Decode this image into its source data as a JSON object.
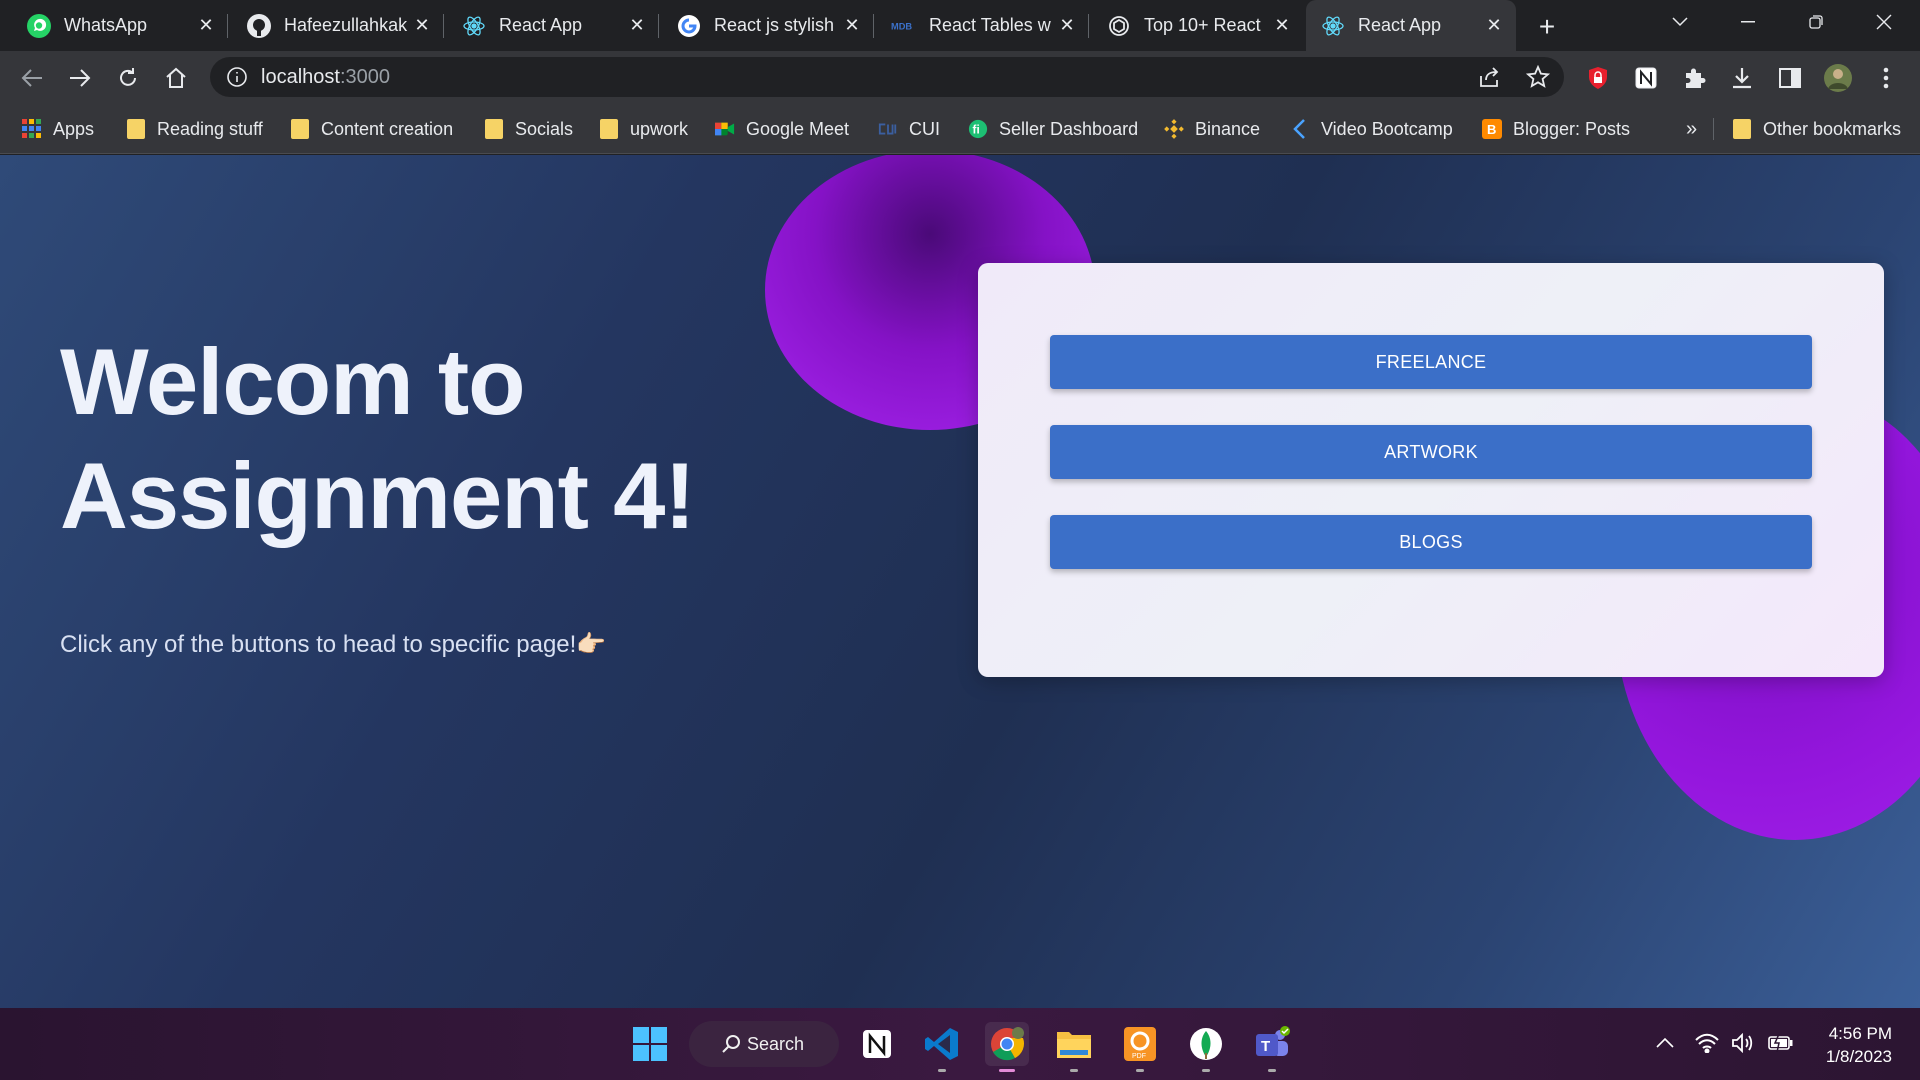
{
  "tabs": [
    {
      "title": "WhatsApp",
      "icon": "whatsapp-icon"
    },
    {
      "title": "Hafeezullahkak",
      "icon": "github-icon"
    },
    {
      "title": "React App",
      "icon": "react-icon"
    },
    {
      "title": "React js stylish",
      "icon": "google-icon"
    },
    {
      "title": "React Tables w",
      "icon": "mdb-icon"
    },
    {
      "title": "Top 10+ React",
      "icon": "openai-icon"
    },
    {
      "title": "React App",
      "icon": "react-icon",
      "active": true
    }
  ],
  "address_bar": {
    "host": "localhost",
    "port": ":3000"
  },
  "bookmarks": [
    {
      "label": "Apps",
      "icon": "apps-grid-icon"
    },
    {
      "label": "Reading stuff",
      "icon": "folder-icon"
    },
    {
      "label": "Content creation",
      "icon": "folder-icon"
    },
    {
      "label": "Socials",
      "icon": "folder-icon"
    },
    {
      "label": "upwork",
      "icon": "folder-icon"
    },
    {
      "label": "Google Meet",
      "icon": "google-meet-icon"
    },
    {
      "label": "CUI",
      "icon": "cui-icon"
    },
    {
      "label": "Seller Dashboard",
      "icon": "fiverr-icon"
    },
    {
      "label": "Binance",
      "icon": "binance-icon"
    },
    {
      "label": "Video Bootcamp",
      "icon": "bootcamp-icon"
    },
    {
      "label": "Blogger: Posts",
      "icon": "blogger-icon"
    }
  ],
  "bookmarks_overflow": "»",
  "other_bookmarks": "Other bookmarks",
  "page": {
    "title_line1": "Welcom to",
    "title_line2": "Assignment 4!",
    "subtitle": "Click any of the buttons to head to specific page!👉🏻",
    "buttons": [
      "FREELANCE",
      "ARTWORK",
      "BLOGS"
    ]
  },
  "taskbar": {
    "search_label": "Search",
    "time": "4:56 PM",
    "date": "1/8/2023"
  },
  "colors": {
    "button_blue": "#3b6fc8",
    "blob_purple": "#9416dd",
    "page_navy": "#243660"
  }
}
